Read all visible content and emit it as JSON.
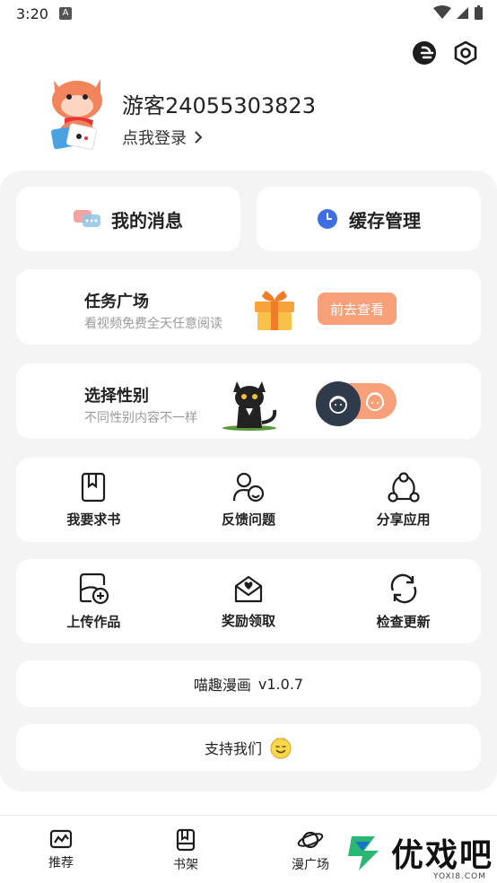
{
  "status_bar": {
    "time": "3:20",
    "a_badge": "A"
  },
  "profile": {
    "username": "游客24055303823",
    "login_text": "点我登录"
  },
  "quick_actions": [
    {
      "label": "我的消息",
      "icon": "chat-bubbles-icon"
    },
    {
      "label": "缓存管理",
      "icon": "clock-icon"
    }
  ],
  "task_banner": {
    "title": "任务广场",
    "subtitle": "看视频免费全天任意阅读",
    "button": "前去查看"
  },
  "gender_banner": {
    "title": "选择性别",
    "subtitle": "不同性别内容不一样"
  },
  "grid_row_1": [
    {
      "label": "我要求书",
      "icon": "bookmark-book-icon"
    },
    {
      "label": "反馈问题",
      "icon": "feedback-user-icon"
    },
    {
      "label": "分享应用",
      "icon": "share-icon"
    }
  ],
  "grid_row_2": [
    {
      "label": "上传作品",
      "icon": "upload-icon"
    },
    {
      "label": "奖励领取",
      "icon": "gift-envelope-icon"
    },
    {
      "label": "检查更新",
      "icon": "refresh-icon"
    }
  ],
  "version": {
    "app_name": "喵趣漫画",
    "version_text": "v1.0.7"
  },
  "support": {
    "label": "支持我们"
  },
  "tabs": [
    {
      "label": "推荐",
      "icon": "recommend-icon"
    },
    {
      "label": "书架",
      "icon": "bookshelf-icon"
    },
    {
      "label": "漫广场",
      "icon": "planet-icon"
    }
  ],
  "watermark": {
    "brand": "优戏吧",
    "url": "YOXI8.COM"
  },
  "colors": {
    "accent": "#f7a07a",
    "panel_bg": "#f4f4f4",
    "knob": "#2f3b4a"
  }
}
